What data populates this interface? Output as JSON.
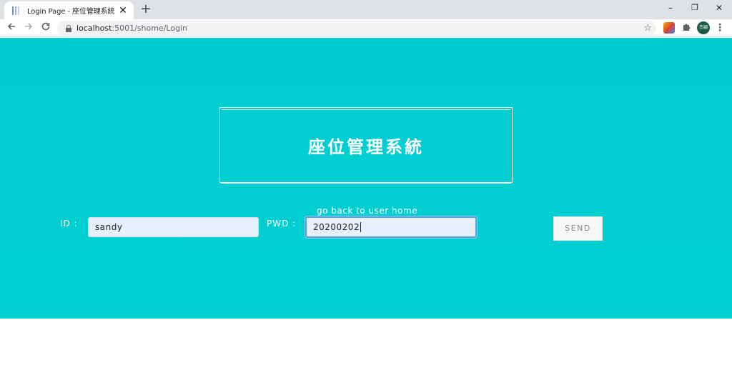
{
  "browser": {
    "tab_title": "Login Page - 座位管理系統",
    "tab_close": "✕",
    "new_tab": "+",
    "url_host": "localhost",
    "url_path": ":5001/shome/Login",
    "window_controls": {
      "minimize": "–",
      "restore": "❐",
      "close": "✕"
    },
    "profile_initials": "杰穎"
  },
  "page": {
    "title": "座位管理系統",
    "id_label": "ID :",
    "pwd_label": "PWD :",
    "id_value": "sandy",
    "pwd_value": "20200202",
    "back_link": "go back to user home",
    "send_label": "SEND"
  },
  "colors": {
    "hero_background": "#00cdd0",
    "input_background": "#e8f0fe",
    "focus_ring": "#4fa3e8"
  },
  "icons": [
    "page-favicon-icon",
    "close-icon",
    "plus-icon",
    "back-arrow-icon",
    "forward-arrow-icon",
    "reload-icon",
    "lock-icon",
    "star-icon",
    "extension-icon",
    "puzzle-icon",
    "more-menu-icon"
  ]
}
